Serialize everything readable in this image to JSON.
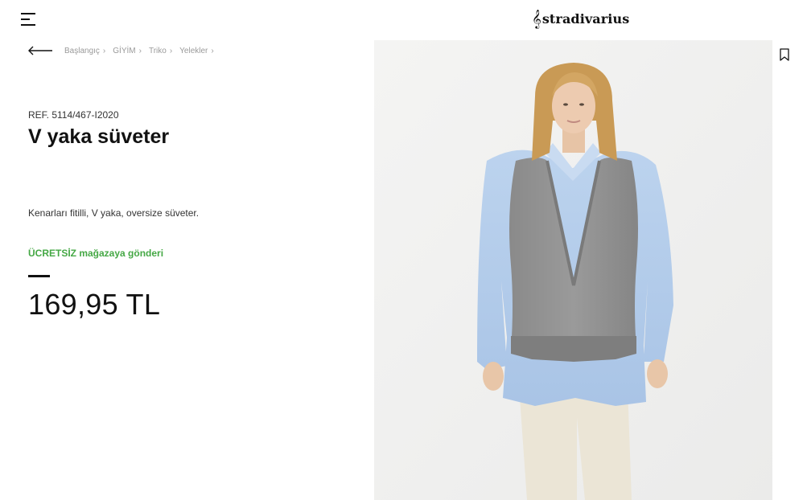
{
  "header": {
    "brand": "stradivarius",
    "menu_icon": "hamburger-menu-icon",
    "logo_icon": "treble-clef-icon"
  },
  "navigation": {
    "back_icon": "arrow-left-icon",
    "breadcrumb": [
      {
        "label": "Başlangıç"
      },
      {
        "label": "GİYİM"
      },
      {
        "label": "Triko"
      },
      {
        "label": "Yelekler"
      }
    ]
  },
  "product": {
    "reference": "REF. 5114/467-I2020",
    "name": "V yaka süveter",
    "description": "Kenarları fitilli, V yaka, oversize süveter.",
    "shipping": "ÜCRETSİZ mağazaya gönderi",
    "price": "169,95 TL",
    "image_alt": "Gri V yaka süveter ve açık mavi gömlek giyen model",
    "wishlist_icon": "bookmark-icon"
  },
  "colors": {
    "accent_green": "#45a845",
    "text_primary": "#111111",
    "breadcrumb_gray": "#9a9a9a",
    "image_background": "#f1f1f1"
  }
}
